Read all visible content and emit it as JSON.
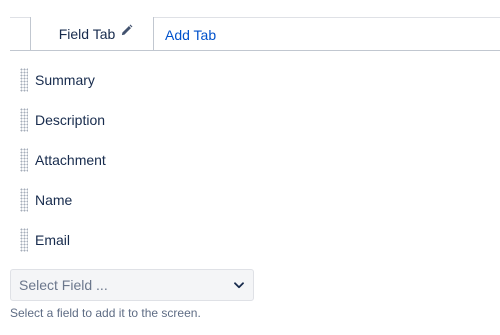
{
  "tabs": {
    "active_label": "Field Tab",
    "active_icon": "pencil-icon",
    "add_label": "Add Tab"
  },
  "fields": [
    {
      "label": "Summary"
    },
    {
      "label": "Description"
    },
    {
      "label": "Attachment"
    },
    {
      "label": "Name"
    },
    {
      "label": "Email"
    }
  ],
  "field_select": {
    "selected": "Select Field ...",
    "icon": "chevron-down-icon",
    "help": "Select a field to add it to the screen."
  },
  "colors": {
    "link": "#0052cc",
    "text": "#172b4d",
    "muted": "#6b778c",
    "border": "#c1c7d0"
  }
}
